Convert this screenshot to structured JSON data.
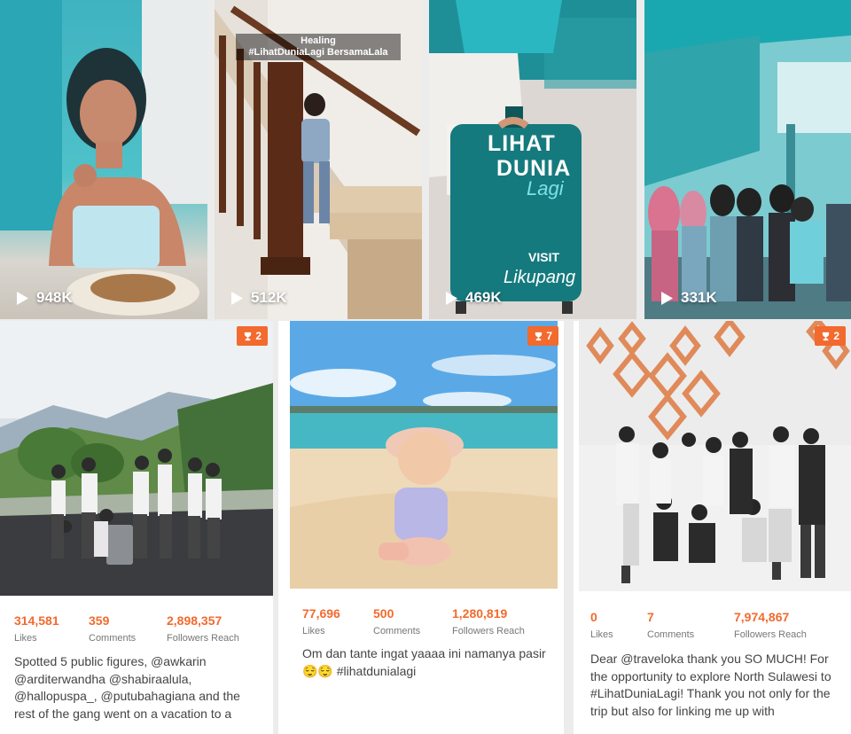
{
  "reels": [
    {
      "views": "948K"
    },
    {
      "views": "512K",
      "caption_line1": "Healing",
      "caption_line2": "#LihatDuniaLagi BersamaLala"
    },
    {
      "views": "469K",
      "suitcase_line1": "LIHAT",
      "suitcase_line2": "DUNIA",
      "suitcase_line3": "Lagi",
      "suitcase_line4": "VISIT",
      "suitcase_line5": "Likupang"
    },
    {
      "views": "331K"
    }
  ],
  "posts": [
    {
      "badge": "2",
      "likes": "314,581",
      "likes_label": "Likes",
      "comments": "359",
      "comments_label": "Comments",
      "reach": "2,898,357",
      "reach_label": "Followers Reach",
      "text": "Spotted 5 public figures, @awkarin @arditerwandha @shabiraalula, @hallopuspa_, @putubahagiana and the rest of the gang went on a vacation to a"
    },
    {
      "badge": "7",
      "likes": "77,696",
      "likes_label": "Likes",
      "comments": "500",
      "comments_label": "Comments",
      "reach": "1,280,819",
      "reach_label": "Followers Reach",
      "text": "Om dan tante ingat yaaaa ini namanya pasir 😌😌 #lihatdunialagi"
    },
    {
      "badge": "2",
      "likes": "0",
      "likes_label": "Likes",
      "comments": "7",
      "comments_label": "Comments",
      "reach": "7,974,867",
      "reach_label": "Followers Reach",
      "text": "Dear @traveloka thank you SO MUCH! For the opportunity to explore North Sulawesi to #LihatDuniaLagi! Thank you not only for the trip but also for linking me up with"
    }
  ],
  "colors": {
    "accent": "#f26a2e",
    "text": "#444444",
    "label": "#777777"
  }
}
